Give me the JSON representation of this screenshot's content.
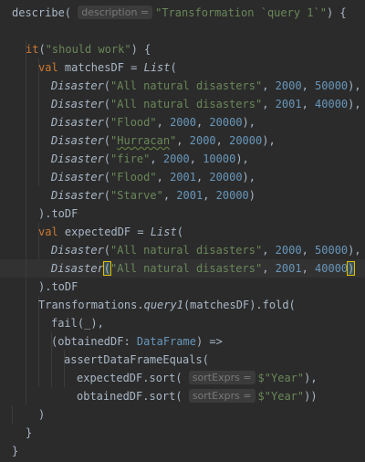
{
  "editor": {
    "language": "Scala",
    "theme": "Darcula",
    "current_line": 15,
    "colors": {
      "background": "#2b2b2b",
      "current_line_highlight": "#323232",
      "default_text": "#a9b7c6",
      "keyword": "#cc7832",
      "string": "#6a8759",
      "number": "#6897bb",
      "inlay_hint_bg": "#3b3b3b",
      "inlay_hint_text": "#787878",
      "matched_bracket_outline": "#e0c000"
    },
    "lines": [
      [
        {
          "t": "describe( ",
          "c": "plain"
        },
        {
          "t": "description =",
          "c": "hint",
          "name": "param-hint-description"
        },
        {
          "t": "\"Transformation `query 1`\"",
          "c": "str"
        },
        {
          "t": ") {",
          "c": "plain"
        }
      ],
      [],
      [
        {
          "t": "it",
          "c": "kw"
        },
        {
          "t": "(",
          "c": "plain"
        },
        {
          "t": "\"should work\"",
          "c": "str"
        },
        {
          "t": ") {",
          "c": "plain"
        }
      ],
      [
        {
          "t": "val ",
          "c": "kw"
        },
        {
          "t": "matchesDF = ",
          "c": "plain"
        },
        {
          "t": "List",
          "c": "fn"
        },
        {
          "t": "(",
          "c": "plain"
        }
      ],
      [
        {
          "t": "Disaster",
          "c": "fn"
        },
        {
          "t": "(",
          "c": "plain"
        },
        {
          "t": "\"All natural disasters\"",
          "c": "str"
        },
        {
          "t": ", ",
          "c": "plain"
        },
        {
          "t": "2000",
          "c": "num"
        },
        {
          "t": ", ",
          "c": "plain"
        },
        {
          "t": "50000",
          "c": "num"
        },
        {
          "t": "),",
          "c": "plain"
        }
      ],
      [
        {
          "t": "Disaster",
          "c": "fn"
        },
        {
          "t": "(",
          "c": "plain"
        },
        {
          "t": "\"All natural disasters\"",
          "c": "str"
        },
        {
          "t": ", ",
          "c": "plain"
        },
        {
          "t": "2001",
          "c": "num"
        },
        {
          "t": ", ",
          "c": "plain"
        },
        {
          "t": "40000",
          "c": "num"
        },
        {
          "t": "),",
          "c": "plain"
        }
      ],
      [
        {
          "t": "Disaster",
          "c": "fn"
        },
        {
          "t": "(",
          "c": "plain"
        },
        {
          "t": "\"Flood\"",
          "c": "str"
        },
        {
          "t": ", ",
          "c": "plain"
        },
        {
          "t": "2000",
          "c": "num"
        },
        {
          "t": ", ",
          "c": "plain"
        },
        {
          "t": "20000",
          "c": "num"
        },
        {
          "t": "),",
          "c": "plain"
        }
      ],
      [
        {
          "t": "Disaster",
          "c": "fn"
        },
        {
          "t": "(",
          "c": "plain"
        },
        {
          "t": "\"",
          "c": "str"
        },
        {
          "t": "Hurracan",
          "c": "str",
          "wavy": true
        },
        {
          "t": "\"",
          "c": "str"
        },
        {
          "t": ", ",
          "c": "plain"
        },
        {
          "t": "2000",
          "c": "num"
        },
        {
          "t": ", ",
          "c": "plain"
        },
        {
          "t": "20000",
          "c": "num"
        },
        {
          "t": "),",
          "c": "plain"
        }
      ],
      [
        {
          "t": "Disaster",
          "c": "fn"
        },
        {
          "t": "(",
          "c": "plain"
        },
        {
          "t": "\"fire\"",
          "c": "str"
        },
        {
          "t": ", ",
          "c": "plain"
        },
        {
          "t": "2000",
          "c": "num"
        },
        {
          "t": ", ",
          "c": "plain"
        },
        {
          "t": "10000",
          "c": "num"
        },
        {
          "t": "),",
          "c": "plain"
        }
      ],
      [
        {
          "t": "Disaster",
          "c": "fn"
        },
        {
          "t": "(",
          "c": "plain"
        },
        {
          "t": "\"Flood\"",
          "c": "str"
        },
        {
          "t": ", ",
          "c": "plain"
        },
        {
          "t": "2001",
          "c": "num"
        },
        {
          "t": ", ",
          "c": "plain"
        },
        {
          "t": "20000",
          "c": "num"
        },
        {
          "t": "),",
          "c": "plain"
        }
      ],
      [
        {
          "t": "Disaster",
          "c": "fn"
        },
        {
          "t": "(",
          "c": "plain"
        },
        {
          "t": "\"Starve\"",
          "c": "str"
        },
        {
          "t": ", ",
          "c": "plain"
        },
        {
          "t": "2001",
          "c": "num"
        },
        {
          "t": ", ",
          "c": "plain"
        },
        {
          "t": "20000",
          "c": "num"
        },
        {
          "t": ")",
          "c": "plain"
        }
      ],
      [
        {
          "t": ").toDF",
          "c": "plain"
        }
      ],
      [
        {
          "t": "val ",
          "c": "kw"
        },
        {
          "t": "expectedDF = ",
          "c": "plain"
        },
        {
          "t": "List",
          "c": "fn"
        },
        {
          "t": "(",
          "c": "plain"
        }
      ],
      [
        {
          "t": "Disaster",
          "c": "fn"
        },
        {
          "t": "(",
          "c": "plain"
        },
        {
          "t": "\"All natural disasters\"",
          "c": "str"
        },
        {
          "t": ", ",
          "c": "plain"
        },
        {
          "t": "2000",
          "c": "num"
        },
        {
          "t": ", ",
          "c": "plain"
        },
        {
          "t": "50000",
          "c": "num"
        },
        {
          "t": "),",
          "c": "plain"
        }
      ],
      [
        {
          "t": "Disaster",
          "c": "fn"
        },
        {
          "t": "(",
          "c": "bracket",
          "name": "matched-bracket-open"
        },
        {
          "t": "\"All natural disasters\"",
          "c": "str"
        },
        {
          "t": ", ",
          "c": "plain"
        },
        {
          "t": "2001",
          "c": "num"
        },
        {
          "t": ", ",
          "c": "plain"
        },
        {
          "t": "40000",
          "c": "num"
        },
        {
          "t": ")",
          "c": "bracket",
          "name": "matched-bracket-close"
        },
        {
          "caret": true
        }
      ],
      [
        {
          "t": ").toDF",
          "c": "plain"
        }
      ],
      [
        {
          "t": "Transformations.",
          "c": "plain"
        },
        {
          "t": "query1",
          "c": "fn"
        },
        {
          "t": "(matchesDF).fold(",
          "c": "plain"
        }
      ],
      [
        {
          "t": "fail(_),",
          "c": "plain"
        }
      ],
      [
        {
          "t": "(obtainedDF: ",
          "c": "plain"
        },
        {
          "t": "DataFrame",
          "c": "type"
        },
        {
          "t": ") =>",
          "c": "plain"
        }
      ],
      [
        {
          "t": "assertDataFrameEquals(",
          "c": "plain"
        }
      ],
      [
        {
          "t": "expectedDF.sort( ",
          "c": "plain"
        },
        {
          "t": "sortExprs =",
          "c": "hint",
          "name": "param-hint-sortexprs"
        },
        {
          "t": "$\"Year\"",
          "c": "str"
        },
        {
          "t": "),",
          "c": "plain"
        }
      ],
      [
        {
          "t": "obtainedDF.sort( ",
          "c": "plain"
        },
        {
          "t": "sortExprs =",
          "c": "hint",
          "name": "param-hint-sortexprs"
        },
        {
          "t": "$\"Year\"",
          "c": "str"
        },
        {
          "t": "))",
          "c": "plain"
        }
      ],
      [
        {
          "t": ")",
          "c": "plain"
        }
      ],
      [
        {
          "t": "}",
          "c": "plain"
        }
      ],
      [
        {
          "t": "}",
          "c": "plain"
        }
      ]
    ]
  }
}
